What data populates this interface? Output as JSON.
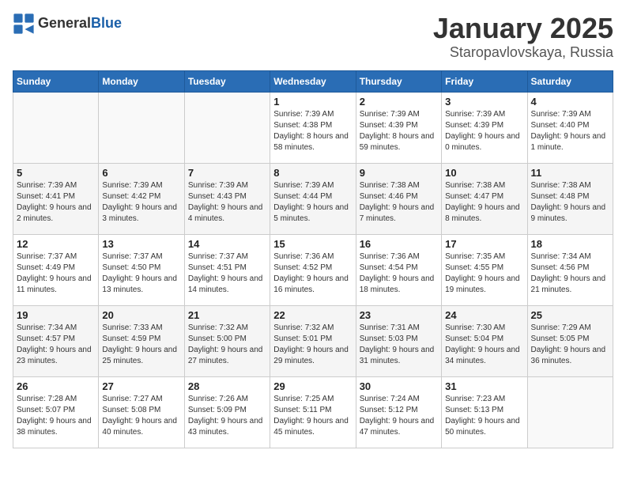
{
  "logo": {
    "general": "General",
    "blue": "Blue"
  },
  "title": "January 2025",
  "location": "Staropavlovskaya, Russia",
  "days_of_week": [
    "Sunday",
    "Monday",
    "Tuesday",
    "Wednesday",
    "Thursday",
    "Friday",
    "Saturday"
  ],
  "weeks": [
    [
      {
        "day": "",
        "info": ""
      },
      {
        "day": "",
        "info": ""
      },
      {
        "day": "",
        "info": ""
      },
      {
        "day": "1",
        "info": "Sunrise: 7:39 AM\nSunset: 4:38 PM\nDaylight: 8 hours\nand 58 minutes."
      },
      {
        "day": "2",
        "info": "Sunrise: 7:39 AM\nSunset: 4:39 PM\nDaylight: 8 hours\nand 59 minutes."
      },
      {
        "day": "3",
        "info": "Sunrise: 7:39 AM\nSunset: 4:39 PM\nDaylight: 9 hours\nand 0 minutes."
      },
      {
        "day": "4",
        "info": "Sunrise: 7:39 AM\nSunset: 4:40 PM\nDaylight: 9 hours\nand 1 minute."
      }
    ],
    [
      {
        "day": "5",
        "info": "Sunrise: 7:39 AM\nSunset: 4:41 PM\nDaylight: 9 hours\nand 2 minutes."
      },
      {
        "day": "6",
        "info": "Sunrise: 7:39 AM\nSunset: 4:42 PM\nDaylight: 9 hours\nand 3 minutes."
      },
      {
        "day": "7",
        "info": "Sunrise: 7:39 AM\nSunset: 4:43 PM\nDaylight: 9 hours\nand 4 minutes."
      },
      {
        "day": "8",
        "info": "Sunrise: 7:39 AM\nSunset: 4:44 PM\nDaylight: 9 hours\nand 5 minutes."
      },
      {
        "day": "9",
        "info": "Sunrise: 7:38 AM\nSunset: 4:46 PM\nDaylight: 9 hours\nand 7 minutes."
      },
      {
        "day": "10",
        "info": "Sunrise: 7:38 AM\nSunset: 4:47 PM\nDaylight: 9 hours\nand 8 minutes."
      },
      {
        "day": "11",
        "info": "Sunrise: 7:38 AM\nSunset: 4:48 PM\nDaylight: 9 hours\nand 9 minutes."
      }
    ],
    [
      {
        "day": "12",
        "info": "Sunrise: 7:37 AM\nSunset: 4:49 PM\nDaylight: 9 hours\nand 11 minutes."
      },
      {
        "day": "13",
        "info": "Sunrise: 7:37 AM\nSunset: 4:50 PM\nDaylight: 9 hours\nand 13 minutes."
      },
      {
        "day": "14",
        "info": "Sunrise: 7:37 AM\nSunset: 4:51 PM\nDaylight: 9 hours\nand 14 minutes."
      },
      {
        "day": "15",
        "info": "Sunrise: 7:36 AM\nSunset: 4:52 PM\nDaylight: 9 hours\nand 16 minutes."
      },
      {
        "day": "16",
        "info": "Sunrise: 7:36 AM\nSunset: 4:54 PM\nDaylight: 9 hours\nand 18 minutes."
      },
      {
        "day": "17",
        "info": "Sunrise: 7:35 AM\nSunset: 4:55 PM\nDaylight: 9 hours\nand 19 minutes."
      },
      {
        "day": "18",
        "info": "Sunrise: 7:34 AM\nSunset: 4:56 PM\nDaylight: 9 hours\nand 21 minutes."
      }
    ],
    [
      {
        "day": "19",
        "info": "Sunrise: 7:34 AM\nSunset: 4:57 PM\nDaylight: 9 hours\nand 23 minutes."
      },
      {
        "day": "20",
        "info": "Sunrise: 7:33 AM\nSunset: 4:59 PM\nDaylight: 9 hours\nand 25 minutes."
      },
      {
        "day": "21",
        "info": "Sunrise: 7:32 AM\nSunset: 5:00 PM\nDaylight: 9 hours\nand 27 minutes."
      },
      {
        "day": "22",
        "info": "Sunrise: 7:32 AM\nSunset: 5:01 PM\nDaylight: 9 hours\nand 29 minutes."
      },
      {
        "day": "23",
        "info": "Sunrise: 7:31 AM\nSunset: 5:03 PM\nDaylight: 9 hours\nand 31 minutes."
      },
      {
        "day": "24",
        "info": "Sunrise: 7:30 AM\nSunset: 5:04 PM\nDaylight: 9 hours\nand 34 minutes."
      },
      {
        "day": "25",
        "info": "Sunrise: 7:29 AM\nSunset: 5:05 PM\nDaylight: 9 hours\nand 36 minutes."
      }
    ],
    [
      {
        "day": "26",
        "info": "Sunrise: 7:28 AM\nSunset: 5:07 PM\nDaylight: 9 hours\nand 38 minutes."
      },
      {
        "day": "27",
        "info": "Sunrise: 7:27 AM\nSunset: 5:08 PM\nDaylight: 9 hours\nand 40 minutes."
      },
      {
        "day": "28",
        "info": "Sunrise: 7:26 AM\nSunset: 5:09 PM\nDaylight: 9 hours\nand 43 minutes."
      },
      {
        "day": "29",
        "info": "Sunrise: 7:25 AM\nSunset: 5:11 PM\nDaylight: 9 hours\nand 45 minutes."
      },
      {
        "day": "30",
        "info": "Sunrise: 7:24 AM\nSunset: 5:12 PM\nDaylight: 9 hours\nand 47 minutes."
      },
      {
        "day": "31",
        "info": "Sunrise: 7:23 AM\nSunset: 5:13 PM\nDaylight: 9 hours\nand 50 minutes."
      },
      {
        "day": "",
        "info": ""
      }
    ]
  ]
}
